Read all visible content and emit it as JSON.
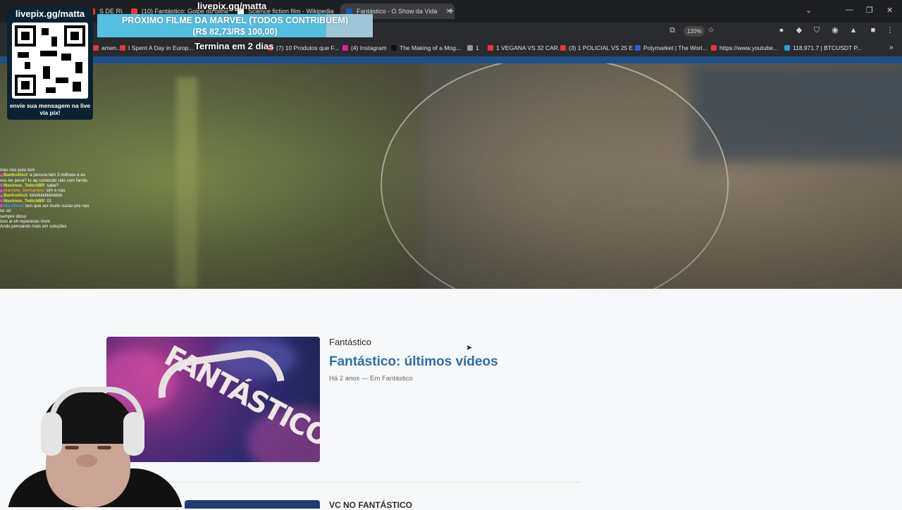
{
  "browser": {
    "tabs": [
      {
        "label": "S DE RU",
        "fav": "#e53935"
      },
      {
        "label": "(10) Fantástico: Golpe do bilhe",
        "fav": "#e53935"
      },
      {
        "label": "Science fiction film - Wikipedia",
        "fav": "#ffffff"
      },
      {
        "label": "Fantástico - O Show da Vida",
        "fav": "#1f5aa6",
        "active": true
      }
    ],
    "zoom": "120%",
    "bookmarks": [
      {
        "label": "amen...",
        "fav": "#e53935"
      },
      {
        "label": "I Spent A Day in Europ...",
        "fav": "#e53935"
      },
      {
        "label": "(7) 10 Produtos que F...",
        "fav": "#e53935"
      },
      {
        "label": "(4) Instagram",
        "fav": "#d6249f"
      },
      {
        "label": "The Making of a Mog...",
        "fav": "#111111"
      },
      {
        "label": "1",
        "fav": "#999999"
      },
      {
        "label": "1 VEGANA VS 32 CAR...",
        "fav": "#e53935"
      },
      {
        "label": "(3) 1 POLICIAL VS 25 E...",
        "fav": "#e53935"
      },
      {
        "label": "Polymarket | The Worl...",
        "fav": "#2c5fd6"
      },
      {
        "label": "https://www.youtube...",
        "fav": "#e53935"
      },
      {
        "label": "118,971.7 | BTCUSDT P...",
        "fav": "#2c9fd6"
      }
    ]
  },
  "overlay": {
    "qr_header": "livepix.gg/matta",
    "qr_footer": "envie sua mensagem na live via pix!",
    "top_handle": "livepix.gg/matta",
    "goal_title": "PRÓXIMO FILME DA MARVEL (TODOS CONTRIBUEM)",
    "goal_amount": "(R$ 82,73/R$ 100,00)",
    "goal_progress": 0.83,
    "timer": "Termina em 2 dias"
  },
  "chat": [
    {
      "user": "",
      "text": "mas rico puro tom",
      "color": "#ffffff"
    },
    {
      "user": "BanInstinct",
      "text": "a pessoa tem 3 milhoes e eu vou ter pena? to aq comendo rato com farofa",
      "color": "#e8e84a"
    },
    {
      "user": "Maximus_TwitchBR",
      "text": "sabe?",
      "color": "#e8e84a"
    },
    {
      "user": "marcelo_bernardes",
      "text": "sim e nao",
      "color": "#d6a64a"
    },
    {
      "user": "BanInstinct",
      "text": "kkkkkkkkkkkkkkk",
      "color": "#e8e84a"
    },
    {
      "user": "Maximus_TwitchBR",
      "text": "01",
      "color": "#e8e84a"
    },
    {
      "user": "MizuShot",
      "text": "tem que ser muito cuzao pra nao ter dó",
      "color": "#4a9de8"
    },
    {
      "user": "",
      "text": "sempre idoso",
      "color": "#d64a4a"
    },
    {
      "user": "",
      "text": "isso ai eh reparacao msm",
      "color": "#d64a4a"
    },
    {
      "user": "",
      "text": "Ando pensando mais em soluções",
      "color": "#d64a4a"
    }
  ],
  "article": {
    "category": "Fantástico",
    "title": "Fantástico: últimos vídeos",
    "meta": "Há 2 anos — Em Fantástico",
    "thumb_logo": "FANTÁSTICO"
  },
  "next_article": {
    "category": "VC NO FANTÁSTICO"
  }
}
